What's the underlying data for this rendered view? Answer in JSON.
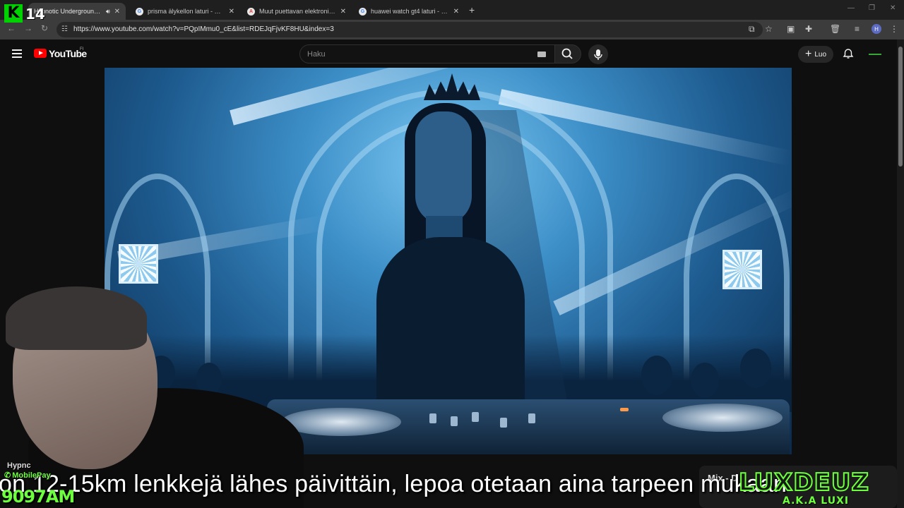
{
  "browser": {
    "tabs": [
      {
        "label": "Hypnotic Underground Ho",
        "active": true
      },
      {
        "label": "prisma älykellon laturi - Google",
        "active": false
      },
      {
        "label": "Muut puettavan elektroniikan t",
        "active": false
      },
      {
        "label": "huawei watch gt4 laturi - Goog",
        "active": false
      }
    ],
    "url": "https://www.youtube.com/watch?v=PQpIMmu0_cE&list=RDEJqFjvKF8HU&index=3",
    "profile_initial": "H"
  },
  "youtube": {
    "logo_text": "YouTube",
    "country_code": "FI",
    "search_placeholder": "Haku",
    "create_label": "Luo"
  },
  "overlay": {
    "logo_k": "K",
    "logo_number": "14",
    "caption": "on 12-15km lenkkejä lähes päivittäin, lepoa otetaan aina tarpeen mukaan",
    "hypno_label": "Hypnc",
    "mobilepay_label": "MobilePay",
    "mobilepay_number": "9097AM",
    "mix_label": "Mix - D",
    "brand_name": "LUXDEUZ",
    "brand_sub": "A.K.A LUXI"
  },
  "colors": {
    "youtube_red": "#ff0000",
    "overlay_green": "#6dff3d",
    "k14_green": "#00d100"
  }
}
